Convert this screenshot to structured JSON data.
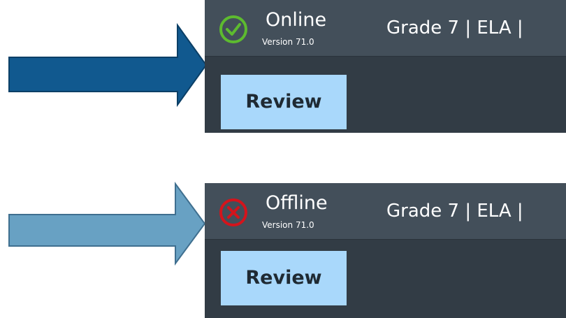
{
  "colors": {
    "arrow_top": "#11598f",
    "arrow_bottom": "#68a1c3",
    "online": "#5dbb2f",
    "offline": "#d4141c",
    "panel_bg": "#323c45",
    "bar_bg": "#434f5a",
    "button_bg": "#a9d8fb"
  },
  "states": [
    {
      "status_icon": "check-circle-icon",
      "status": "Online",
      "version": "Version 71.0",
      "context": "Grade 7 |  ELA |",
      "review_label": "Review"
    },
    {
      "status_icon": "x-circle-icon",
      "status": "Offline",
      "version": "Version 71.0",
      "context": "Grade 7 |  ELA |",
      "review_label": "Review"
    }
  ]
}
